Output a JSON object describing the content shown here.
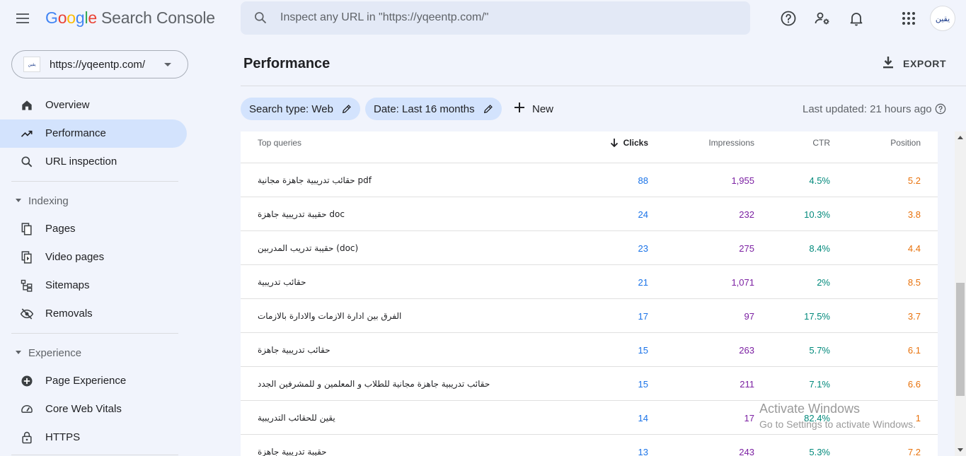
{
  "header": {
    "logo": {
      "g1": "G",
      "g2": "o",
      "g3": "o",
      "g4": "g",
      "g5": "l",
      "g6": "e",
      "product": "Search Console"
    },
    "search_placeholder": "Inspect any URL in \"https://yqeentp.com/\"",
    "avatar_text": "يقين"
  },
  "sidebar": {
    "property": {
      "url": "https://yqeentp.com/",
      "favicon_text": "يقين"
    },
    "main_items": [
      {
        "label": "Overview",
        "icon": "home-icon"
      },
      {
        "label": "Performance",
        "icon": "trending-up-icon",
        "active": true
      },
      {
        "label": "URL inspection",
        "icon": "search-icon"
      }
    ],
    "sections": [
      {
        "title": "Indexing",
        "items": [
          {
            "label": "Pages",
            "icon": "pages-icon"
          },
          {
            "label": "Video pages",
            "icon": "video-pages-icon"
          },
          {
            "label": "Sitemaps",
            "icon": "sitemap-icon"
          },
          {
            "label": "Removals",
            "icon": "eye-off-icon"
          }
        ]
      },
      {
        "title": "Experience",
        "items": [
          {
            "label": "Page Experience",
            "icon": "page-experience-icon"
          },
          {
            "label": "Core Web Vitals",
            "icon": "gauge-icon"
          },
          {
            "label": "HTTPS",
            "icon": "lock-icon"
          }
        ]
      }
    ]
  },
  "main": {
    "title": "Performance",
    "export_label": "EXPORT",
    "filters": [
      {
        "label": "Search type: Web"
      },
      {
        "label": "Date: Last 16 months"
      }
    ],
    "new_label": "New",
    "last_updated": "Last updated: 21 hours ago",
    "table": {
      "headers": {
        "query": "Top queries",
        "clicks": "Clicks",
        "impressions": "Impressions",
        "ctr": "CTR",
        "position": "Position"
      },
      "rows": [
        {
          "query": "حقائب تدريبية جاهزة مجانية pdf",
          "clicks": "88",
          "impressions": "1,955",
          "ctr": "4.5%",
          "position": "5.2"
        },
        {
          "query": "حقيبة تدريبية جاهزة doc",
          "clicks": "24",
          "impressions": "232",
          "ctr": "10.3%",
          "position": "3.8"
        },
        {
          "query": "حقيبة تدريب المدربين (doc)",
          "clicks": "23",
          "impressions": "275",
          "ctr": "8.4%",
          "position": "4.4"
        },
        {
          "query": "حقائب تدريبية",
          "clicks": "21",
          "impressions": "1,071",
          "ctr": "2%",
          "position": "8.5"
        },
        {
          "query": "الفرق بين ادارة الازمات والادارة بالازمات",
          "clicks": "17",
          "impressions": "97",
          "ctr": "17.5%",
          "position": "3.7"
        },
        {
          "query": "حقائب تدريبية جاهزة",
          "clicks": "15",
          "impressions": "263",
          "ctr": "5.7%",
          "position": "6.1"
        },
        {
          "query": "حقائب تدريبية جاهزة مجانية للطلاب و المعلمين و للمشرفين الجدد",
          "clicks": "15",
          "impressions": "211",
          "ctr": "7.1%",
          "position": "6.6"
        },
        {
          "query": "يقين للحقائب التدريبية",
          "clicks": "14",
          "impressions": "17",
          "ctr": "82.4%",
          "position": "1"
        },
        {
          "query": "حقيبة تدريبية جاهزة",
          "clicks": "13",
          "impressions": "243",
          "ctr": "5.3%",
          "position": "7.2"
        }
      ]
    }
  },
  "watermark": {
    "line1": "Activate Windows",
    "line2": "Go to Settings to activate Windows."
  },
  "colors": {
    "clicks": "#1a73e8",
    "impressions": "#7b1fa2",
    "ctr": "#00897b",
    "position": "#e8710a",
    "active_nav": "#d3e3fd"
  }
}
